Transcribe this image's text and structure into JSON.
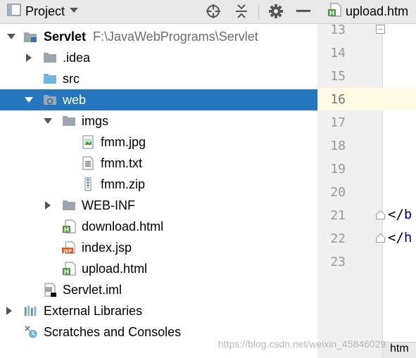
{
  "panel": {
    "title": "Project",
    "icons": [
      "locate-icon",
      "collapse-all-icon",
      "gear-icon",
      "minimize-icon"
    ]
  },
  "tree": [
    {
      "label": "Servlet",
      "path": "F:\\JavaWebPrograms\\Servlet",
      "icon": "module-folder",
      "expanded": true,
      "selected": false
    },
    {
      "label": ".idea",
      "icon": "folder",
      "expanded": false
    },
    {
      "label": "src",
      "icon": "source-folder"
    },
    {
      "label": "web",
      "icon": "web-folder",
      "expanded": true,
      "selected": true
    },
    {
      "label": "imgs",
      "icon": "folder",
      "expanded": true
    },
    {
      "label": "fmm.jpg",
      "icon": "image-file"
    },
    {
      "label": "fmm.txt",
      "icon": "text-file"
    },
    {
      "label": "fmm.zip",
      "icon": "archive-file"
    },
    {
      "label": "WEB-INF",
      "icon": "folder",
      "expanded": false
    },
    {
      "label": "download.html",
      "icon": "html-file"
    },
    {
      "label": "index.jsp",
      "icon": "jsp-file"
    },
    {
      "label": "upload.html",
      "icon": "html-file"
    },
    {
      "label": "Servlet.iml",
      "icon": "iml-file"
    },
    {
      "label": "External Libraries",
      "icon": "libraries",
      "expanded": false
    },
    {
      "label": "Scratches and Consoles",
      "icon": "scratches"
    }
  ],
  "editor": {
    "tab_label": "upload.htm",
    "line_numbers": [
      "13",
      "14",
      "15",
      "16",
      "17",
      "18",
      "19",
      "20",
      "21",
      "22",
      "23"
    ],
    "current_line": "16",
    "code_lines": {
      "line21": {
        "bracket": "</",
        "tag": "b"
      },
      "line22": {
        "bracket": "</",
        "tag": "h"
      }
    },
    "bottom_tab": "htm"
  },
  "watermark": "https://blog.csdn.net/weixin_45846029",
  "colors": {
    "selection": "#2675bf",
    "folder": "#9aa7b0",
    "source_folder": "#6fb5e0",
    "html_badge": "#4e9a3e",
    "jsp_badge": "#d2632d",
    "current_line": "#fffae3"
  }
}
